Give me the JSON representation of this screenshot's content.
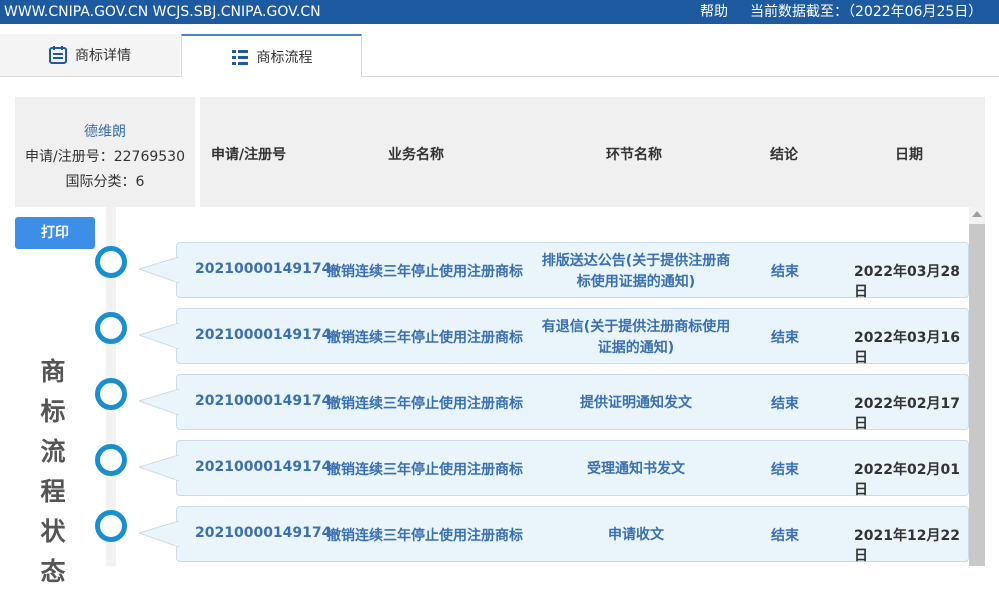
{
  "topbar": {
    "domains": "WWW.CNIPA.GOV.CN WCJS.SBJ.CNIPA.GOV.CN",
    "help": "帮助",
    "cutoff": "当前数据截至：（2022年06月25日）"
  },
  "tabs": [
    {
      "label": "商标详情",
      "icon": "document-icon"
    },
    {
      "label": "商标流程",
      "icon": "list-icon"
    }
  ],
  "info": {
    "name": "德维朗",
    "reg_no": "申请/注册号：22769530",
    "class": "国际分类：6"
  },
  "table": {
    "headers": [
      "申请/注册号",
      "业务名称",
      "环节名称",
      "结论",
      "日期"
    ]
  },
  "print_label": "打印",
  "side_title": [
    "商",
    "标",
    "流",
    "程",
    "状",
    "态"
  ],
  "rows": [
    {
      "reg": "20210000149174",
      "biz": "撤销连续三年停止使用注册商标",
      "step": [
        "排版送达公告(关于提供注册商",
        "标使用证据的通知)"
      ],
      "result": "结束",
      "date": "2022年03月28日"
    },
    {
      "reg": "20210000149174",
      "biz": "撤销连续三年停止使用注册商标",
      "step": [
        "有退信(关于提供注册商标使用",
        "证据的通知)"
      ],
      "result": "结束",
      "date": "2022年03月16日"
    },
    {
      "reg": "20210000149174",
      "biz": "撤销连续三年停止使用注册商标",
      "step": [
        "提供证明通知发文"
      ],
      "result": "结束",
      "date": "2022年02月17日"
    },
    {
      "reg": "20210000149174",
      "biz": "撤销连续三年停止使用注册商标",
      "step": [
        "受理通知书发文"
      ],
      "result": "结束",
      "date": "2022年02月01日"
    },
    {
      "reg": "20210000149174",
      "biz": "撤销连续三年停止使用注册商标",
      "step": [
        "申请收文"
      ],
      "result": "结束",
      "date": "2021年12月22日"
    }
  ]
}
